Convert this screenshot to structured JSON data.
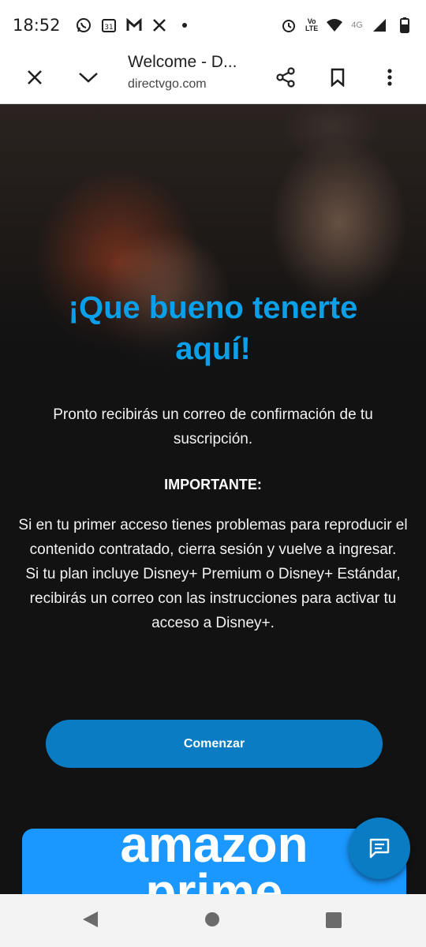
{
  "status_bar": {
    "time": "18:52",
    "left_icons": [
      "whatsapp-icon",
      "calendar-icon",
      "gmail-icon",
      "x-icon",
      "dot-icon"
    ],
    "calendar_day": "31",
    "right_icons": [
      "alarm-icon",
      "volte-icon",
      "wifi-icon",
      "signal-icon",
      "battery-icon"
    ],
    "volte_label_top": "Vo",
    "volte_label_bottom": "LTE",
    "network_label": "4G"
  },
  "browser": {
    "title": "Welcome - D...",
    "url": "directvgo.com",
    "icons": [
      "close-icon",
      "chevron-down-icon",
      "share-icon",
      "bookmark-icon",
      "more-icon"
    ]
  },
  "page": {
    "heading_line1": "¡Que bueno tenerte",
    "heading_line2": "aquí!",
    "confirmation_text": "Pronto recibirás un correo de confirmación de tu suscripción.",
    "important_label": "IMPORTANTE:",
    "instructions_text_1": "Si en tu primer acceso tienes problemas para reproducir el contenido contratado, cierra sesión y vuelve a ingresar.",
    "instructions_text_2": "Si tu plan incluye Disney+ Premium o Disney+ Estándar, recibirás un correo con las instrucciones para activar tu acceso a Disney+.",
    "cta_label": "Comenzar",
    "promo_text_line1": "amazon",
    "promo_text_line2": "prime",
    "heading_color": "#0aa0e9",
    "button_color": "#0a7cc4",
    "promo_color": "#1a98ff"
  },
  "navigation": {
    "icons": [
      "back-icon",
      "home-icon",
      "recents-icon"
    ]
  }
}
